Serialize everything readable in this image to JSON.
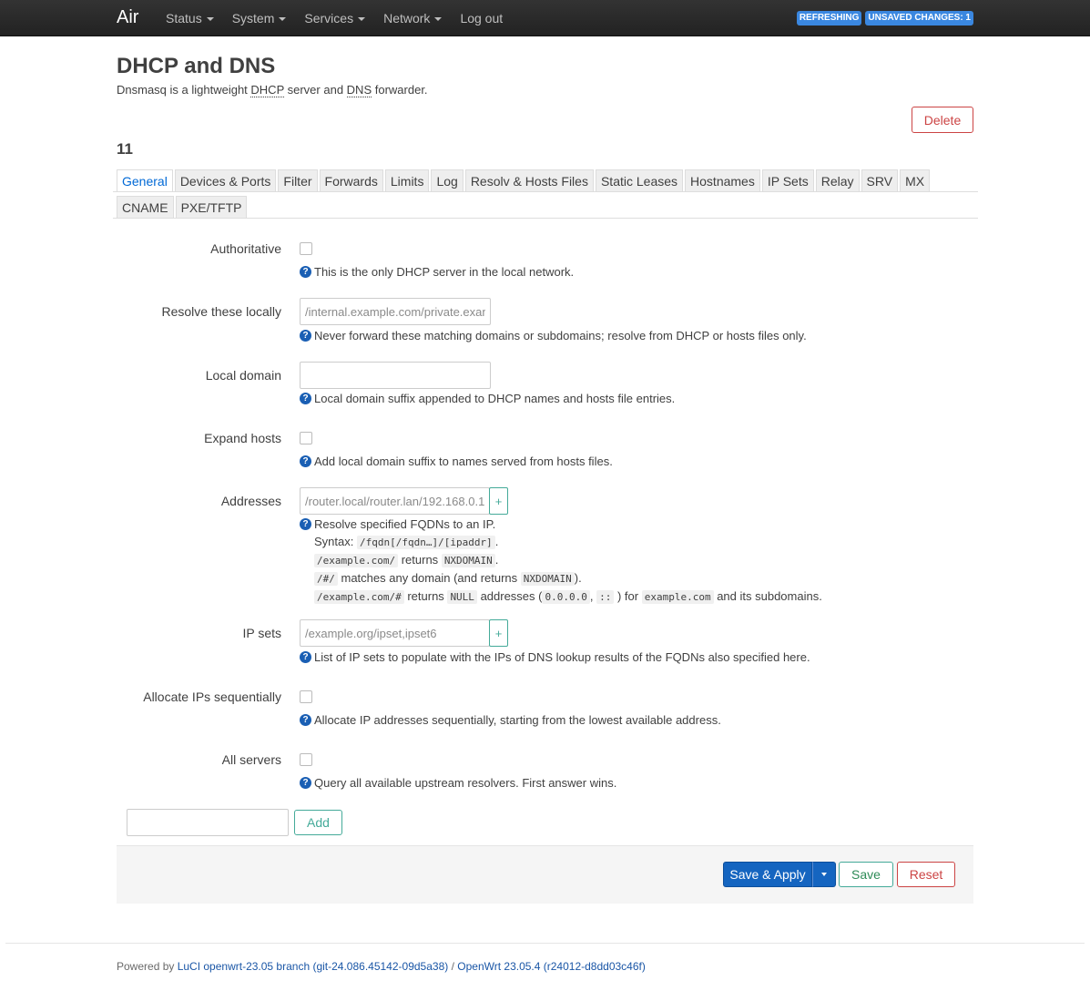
{
  "brand": "Air",
  "nav": [
    "Status",
    "System",
    "Services",
    "Network",
    "Log out"
  ],
  "indicators": [
    "REFRESHING",
    "UNSAVED CHANGES: 1"
  ],
  "page": {
    "title": "DHCP and DNS",
    "desc_pre": "Dnsmasq is a lightweight ",
    "desc_dhcp": "DHCP",
    "desc_mid": " server and ",
    "desc_dns": "DNS",
    "desc_post": " forwarder."
  },
  "delete_label": "Delete",
  "section_title": "11",
  "tabs": [
    "General",
    "Devices & Ports",
    "Filter",
    "Forwards",
    "Limits",
    "Log",
    "Resolv & Hosts Files",
    "Static Leases",
    "Hostnames",
    "IP Sets",
    "Relay",
    "SRV",
    "MX",
    "CNAME",
    "PXE/TFTP"
  ],
  "active_tab": "General",
  "fields": {
    "authoritative": {
      "label": "Authoritative",
      "help": "This is the only DHCP server in the local network."
    },
    "resolve_locally": {
      "label": "Resolve these locally",
      "placeholder": "/internal.example.com/private.example.com/",
      "help": "Never forward these matching domains or subdomains; resolve from DHCP or hosts files only."
    },
    "local_domain": {
      "label": "Local domain",
      "value": "",
      "help": "Local domain suffix appended to DHCP names and hosts file entries."
    },
    "expand_hosts": {
      "label": "Expand hosts",
      "help": "Add local domain suffix to names served from hosts files."
    },
    "addresses": {
      "label": "Addresses",
      "placeholder": "/router.local/router.lan/192.168.0.1",
      "help": "Resolve specified FQDNs to an IP.",
      "syntax_label": "Syntax:",
      "syntax_code": "/fqdn[/fqdn…]/[ipaddr]",
      "syntax_end": ".",
      "ex1_code": "/example.com/",
      "ex1_text": "returns",
      "ex1_code2": "NXDOMAIN",
      "ex1_end": ".",
      "ex2_code": "/#/",
      "ex2_text": "matches any domain (and returns",
      "ex2_code2": "NXDOMAIN",
      "ex2_end": ").",
      "ex3_code": "/example.com/#",
      "ex3_text": "returns",
      "ex3_code2": "NULL",
      "ex3_text2": "addresses (",
      "ex3_code3": "0.0.0.0",
      "ex3_sep": ",",
      "ex3_code4": "::",
      "ex3_text3": ") for",
      "ex3_code5": "example.com",
      "ex3_text4": "and its subdomains."
    },
    "ipsets": {
      "label": "IP sets",
      "placeholder": "/example.org/ipset,ipset6",
      "help": "List of IP sets to populate with the IPs of DNS lookup results of the FQDNs also specified here."
    },
    "sequential_ip": {
      "label": "Allocate IPs sequentially",
      "help": "Allocate IP addresses sequentially, starting from the lowest available address."
    },
    "all_servers": {
      "label": "All servers",
      "help": "Query all available upstream resolvers. First answer wins."
    }
  },
  "add_label": "Add",
  "actions": {
    "save_apply": "Save & Apply",
    "save": "Save",
    "reset": "Reset"
  },
  "footer": {
    "powered": "Powered by ",
    "luci": "LuCI openwrt-23.05 branch (git-24.086.45142-09d5a38)",
    "sep": " / ",
    "openwrt": "OpenWrt 23.05.4 (r24012-d8dd03c46f)"
  },
  "colors": {
    "header_bg": "#222222",
    "badge": "#3a87e0",
    "primary": "#1565c0",
    "danger": "#cc4444",
    "success": "#44aa99"
  }
}
